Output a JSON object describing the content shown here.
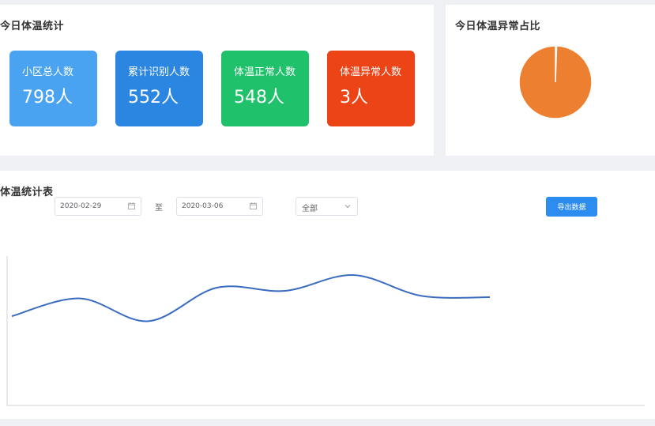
{
  "today_stats": {
    "title": "今日体温统计",
    "cards": [
      {
        "label": "小区总人数",
        "value": "798人",
        "color": "#4aa3f0"
      },
      {
        "label": "累计识别人数",
        "value": "552人",
        "color": "#2b86e2"
      },
      {
        "label": "体温正常人数",
        "value": "548人",
        "color": "#1fc16b"
      },
      {
        "label": "体温异常人数",
        "value": "3人",
        "color": "#ec4317"
      }
    ]
  },
  "abnormal_ratio": {
    "title": "今日体温异常占比",
    "slices": [
      {
        "value": 3,
        "color": "#e8e8e8"
      },
      {
        "value": 545,
        "color": "#ed7f30"
      }
    ]
  },
  "temperature_table": {
    "title": "体温统计表",
    "start_date": "2020-02-29",
    "separator": "至",
    "end_date": "2020-03-06",
    "range_select": "全部",
    "export_label": "导出数据"
  },
  "chart_data": {
    "type": "line",
    "series": [
      {
        "values": [
          0.2,
          0.48,
          0.12,
          0.65,
          0.6,
          0.85,
          0.52,
          0.5
        ],
        "color": "#3a6cc0"
      }
    ],
    "grid": false
  },
  "colors": {
    "accent": "#2d8cf0",
    "line": "#3a6cc0"
  }
}
